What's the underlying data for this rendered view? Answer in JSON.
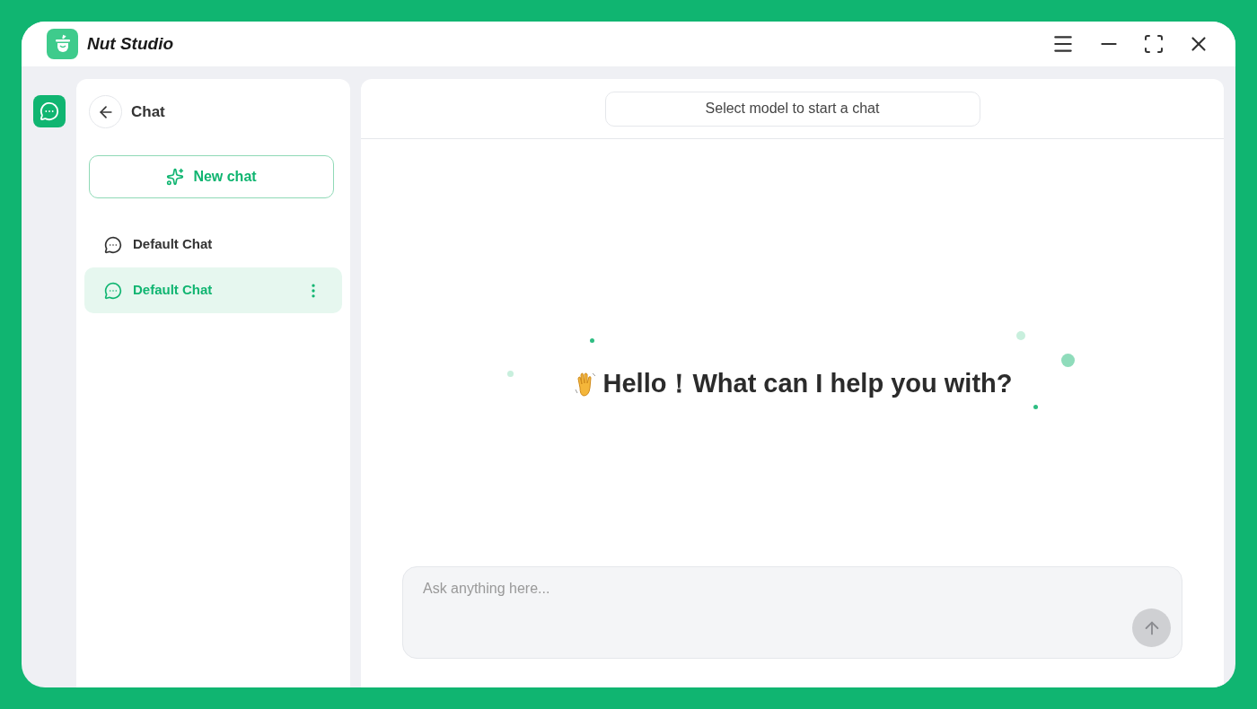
{
  "window": {
    "title": "Nut Studio"
  },
  "sidebar": {
    "title": "Chat",
    "new_chat": "New chat",
    "items": [
      {
        "label": "Default Chat",
        "selected": false
      },
      {
        "label": "Default Chat",
        "selected": true
      }
    ]
  },
  "main": {
    "model_selector": "Select model to start a chat",
    "greeting": "Hello！What can I help you with?",
    "input": {
      "placeholder": "Ask anything here..."
    }
  }
}
